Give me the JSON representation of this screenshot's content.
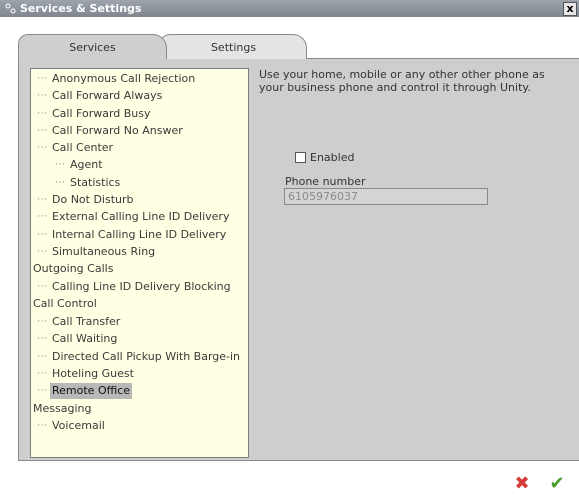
{
  "window": {
    "title": "Services & Settings",
    "close_label": "x"
  },
  "tabs": [
    {
      "label": "Services",
      "active": true
    },
    {
      "label": "Settings",
      "active": false
    }
  ],
  "tree": {
    "items": [
      {
        "label": "Anonymous Call Rejection"
      },
      {
        "label": "Call Forward Always"
      },
      {
        "label": "Call Forward Busy"
      },
      {
        "label": "Call Forward No Answer"
      },
      {
        "label": "Call Center"
      },
      {
        "label": "Agent"
      },
      {
        "label": "Statistics"
      },
      {
        "label": "Do Not Disturb"
      },
      {
        "label": "External Calling Line ID Delivery"
      },
      {
        "label": "Internal Calling Line ID Delivery"
      },
      {
        "label": "Simultaneous Ring"
      },
      {
        "label": "Outgoing Calls"
      },
      {
        "label": "Calling Line ID Delivery Blocking"
      },
      {
        "label": "Call Control"
      },
      {
        "label": "Call Transfer"
      },
      {
        "label": "Call Waiting"
      },
      {
        "label": "Directed Call Pickup With Barge-in"
      },
      {
        "label": "Hoteling Guest"
      },
      {
        "label": "Remote Office",
        "selected": true
      },
      {
        "label": "Messaging"
      },
      {
        "label": "Voicemail"
      }
    ]
  },
  "detail": {
    "description": "Use your home, mobile or any other other phone as your business phone and control it through Unity.",
    "enabled_label": "Enabled",
    "enabled_checked": false,
    "phone_label": "Phone number",
    "phone_value": "6105976037"
  },
  "colors": {
    "tree_background": "#ffffe3",
    "panel_background": "#cecece",
    "cancel_color": "#d43c3c",
    "ok_color": "#4a9a2c"
  },
  "icons": {
    "app": "services-settings-icon",
    "cancel": "red-x-icon",
    "ok": "green-check-icon"
  }
}
